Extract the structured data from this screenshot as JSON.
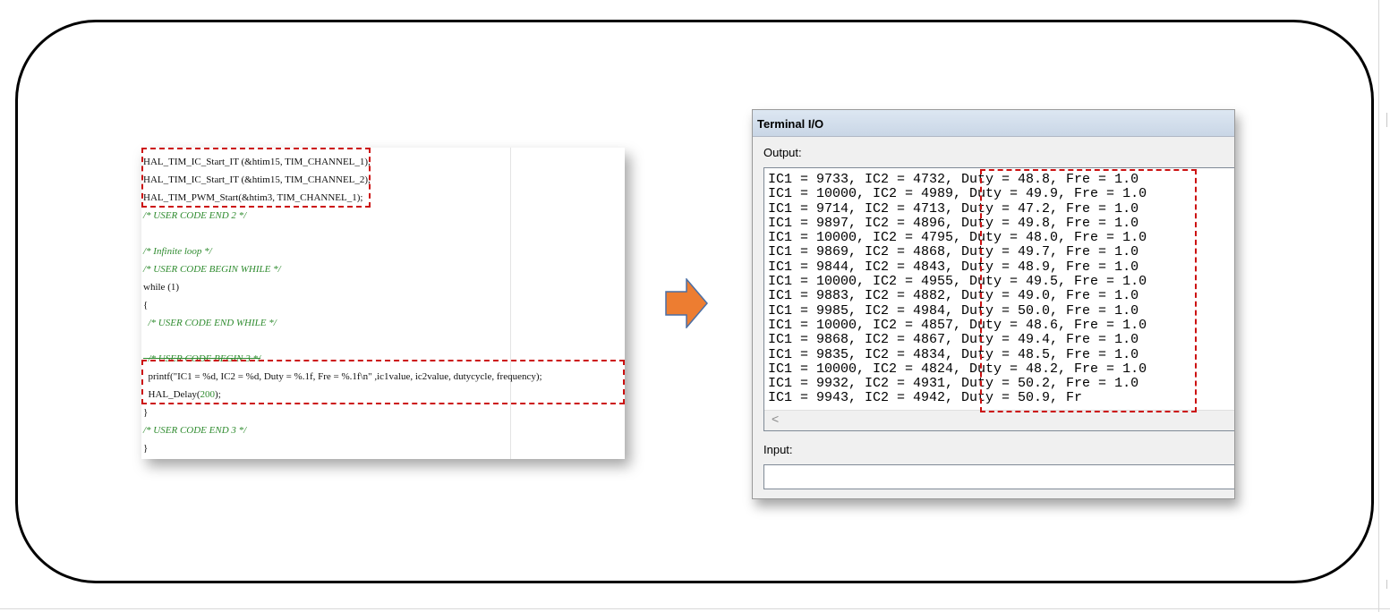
{
  "code": {
    "lines": [
      "HAL_TIM_IC_Start_IT (&htim15, TIM_CHANNEL_1);",
      "HAL_TIM_IC_Start_IT (&htim15, TIM_CHANNEL_2);",
      "HAL_TIM_PWM_Start(&htim3, TIM_CHANNEL_1);",
      "/* USER CODE END 2 */",
      "",
      "/* Infinite loop */",
      "/* USER CODE BEGIN WHILE */",
      "while (1)",
      "{",
      "  /* USER CODE END WHILE */",
      "",
      "  /* USER CODE BEGIN 3 */",
      "  printf(\"IC1 = %d, IC2 = %d, Duty = %.1f, Fre = %.1f\\n\" ,ic1value, ic2value, dutycycle, frequency);",
      "  HAL_Delay(",
      "200",
      ");",
      "}",
      "/* USER CODE END 3 */",
      "}"
    ]
  },
  "arrow": {
    "icon": "arrow-right-icon",
    "color": "#ed7d31"
  },
  "terminal": {
    "title": "Terminal I/O",
    "output_label": "Output:",
    "input_label": "Input:",
    "input_value": "",
    "scroll_left_icon": "<",
    "output_lines": [
      "IC1 = 9733, IC2 = 4732, Duty = 48.8, Fre = 1.0",
      "IC1 = 10000, IC2 = 4989, Duty = 49.9, Fre = 1.0",
      "IC1 = 9714, IC2 = 4713, Duty = 47.2, Fre = 1.0",
      "IC1 = 9897, IC2 = 4896, Duty = 49.8, Fre = 1.0",
      "IC1 = 10000, IC2 = 4795, Duty = 48.0, Fre = 1.0",
      "IC1 = 9869, IC2 = 4868, Duty = 49.7, Fre = 1.0",
      "IC1 = 9844, IC2 = 4843, Duty = 48.9, Fre = 1.0",
      "IC1 = 10000, IC2 = 4955, Duty = 49.5, Fre = 1.0",
      "IC1 = 9883, IC2 = 4882, Duty = 49.0, Fre = 1.0",
      "IC1 = 9985, IC2 = 4984, Duty = 50.0, Fre = 1.0",
      "IC1 = 10000, IC2 = 4857, Duty = 48.6, Fre = 1.0",
      "IC1 = 9868, IC2 = 4867, Duty = 49.4, Fre = 1.0",
      "IC1 = 9835, IC2 = 4834, Duty = 48.5, Fre = 1.0",
      "IC1 = 10000, IC2 = 4824, Duty = 48.2, Fre = 1.0",
      "IC1 = 9932, IC2 = 4931, Duty = 50.2, Fre = 1.0",
      "IC1 = 9943, IC2 = 4942, Duty = 50.9, Fr"
    ]
  },
  "colors": {
    "highlight": "#cc1111",
    "comment": "#2e8b2e",
    "frame": "#000000"
  }
}
